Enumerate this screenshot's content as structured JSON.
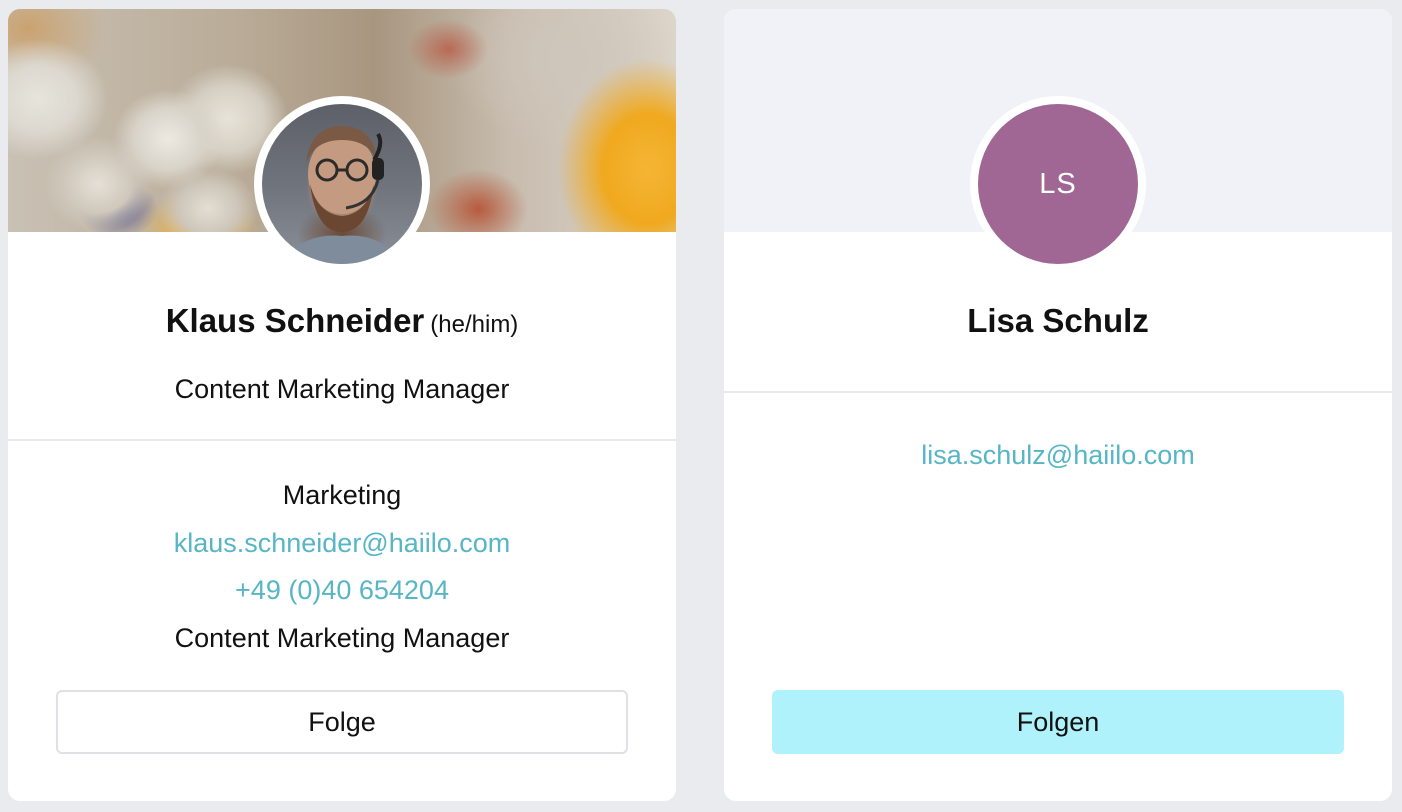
{
  "cards": [
    {
      "name": "Klaus Schneider",
      "pronouns": "(he/him)",
      "job_title": "Content Marketing Manager",
      "department": "Marketing",
      "email": "klaus.schneider@haiilo.com",
      "phone": "+49 (0)40 654204",
      "position": "Content Marketing Manager",
      "follow_button_label": "Folge",
      "avatar": "profile-photo"
    },
    {
      "name": "Lisa Schulz",
      "initials": "LS",
      "email": "lisa.schulz@haiilo.com",
      "follow_button_label": "Folgen",
      "avatar_color": "#a06795",
      "button_color": "#b0f2fb"
    }
  ],
  "colors": {
    "link": "#57b6c5",
    "background": "#e9ebef",
    "card": "#ffffff"
  }
}
